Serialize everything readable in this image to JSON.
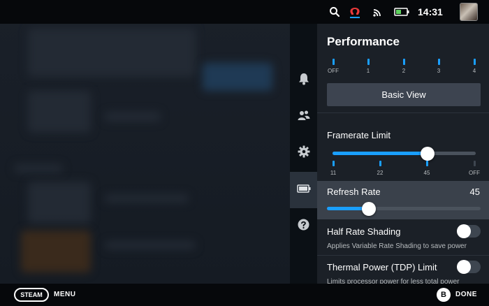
{
  "status_bar": {
    "time": "14:31",
    "icons": [
      "search-icon",
      "omega-icon",
      "wifi-icon",
      "battery-icon",
      "avatar"
    ],
    "accent": "#e8393a"
  },
  "side_rail": {
    "items": [
      {
        "icon": "bell-icon",
        "active": false
      },
      {
        "icon": "friends-icon",
        "active": false
      },
      {
        "icon": "gear-icon",
        "active": false
      },
      {
        "icon": "battery-icon",
        "active": true
      },
      {
        "icon": "help-icon",
        "active": false
      }
    ]
  },
  "performance": {
    "title": "Performance",
    "profile_ticks": [
      "OFF",
      "1",
      "2",
      "3",
      "4"
    ],
    "basic_view_label": "Basic View",
    "framerate": {
      "label": "Framerate Limit",
      "ticks": [
        "11",
        "22",
        "45",
        "OFF"
      ],
      "selected": "45"
    },
    "refresh_rate": {
      "label": "Refresh Rate",
      "value": "45",
      "fill_fraction": 0.27
    },
    "half_rate_shading": {
      "label": "Half Rate Shading",
      "description": "Applies Variable Rate Shading to save power",
      "enabled": false
    },
    "tdp_limit": {
      "label": "Thermal Power (TDP) Limit",
      "description": "Limits processor power for less total power",
      "enabled": false
    }
  },
  "bottom_bar": {
    "steam_label": "STEAM",
    "menu_label": "MENU",
    "b_label": "B",
    "done_label": "DONE"
  },
  "colors": {
    "accent_blue": "#1a9fff",
    "panel_bg": "#1b2027",
    "highlight_row": "#3a414b"
  }
}
